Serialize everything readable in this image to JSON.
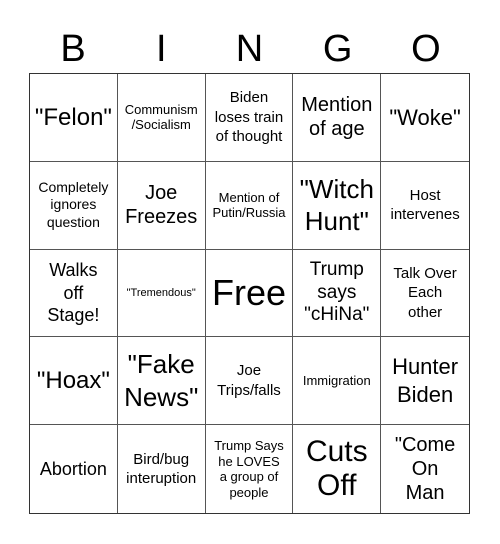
{
  "header": {
    "letters": [
      "B",
      "I",
      "N",
      "G",
      "O"
    ]
  },
  "board": {
    "rows": [
      [
        "\"Felon\"",
        "Communism\n/Socialism",
        "Biden\nloses train\nof thought",
        "Mention\nof age",
        "\"Woke\""
      ],
      [
        "Completely\nignores\nquestion",
        "Joe\nFreezes",
        "Mention of\nPutin/Russia",
        "\"Witch\nHunt\"",
        "Host\nintervenes"
      ],
      [
        "Walks\noff\nStage!",
        "\"Tremendous\"",
        "Free",
        "Trump\nsays\n\"cHiNa\"",
        "Talk Over\nEach\nother"
      ],
      [
        "\"Hoax\"",
        "\"Fake\nNews\"",
        "Joe\nTrips/falls",
        "Immigration",
        "Hunter\nBiden"
      ],
      [
        "Abortion",
        "Bird/bug\ninteruption",
        "Trump Says\nhe LOVES\na group of\npeople",
        "Cuts\nOff",
        "\"Come\nOn\nMan"
      ]
    ],
    "free_space": "Free"
  }
}
